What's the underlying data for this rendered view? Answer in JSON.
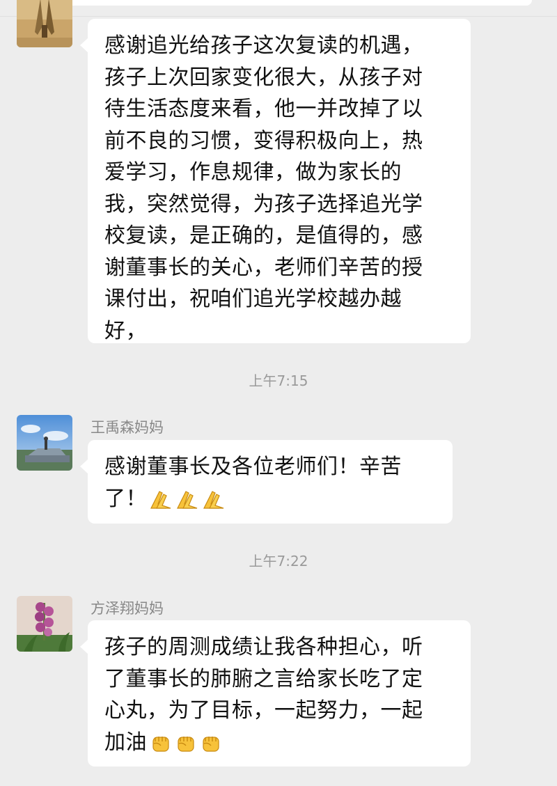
{
  "messages": [
    {
      "sender": "",
      "avatar_icon": "praying-hands-avatar-icon",
      "lines": [
        "感谢追光给孩子这次复读的机遇，",
        "孩子上次回家变化很大，从孩子对",
        "待生活态度来看，他一并改掉了以",
        "前不良的习惯，变得积极向上，热",
        "爱学习，作息规律，做为家长的",
        "我，突然觉得，为孩子选择追光学",
        "校复读，是正确的，是值得的，感",
        "谢董事长的关心，老师们辛苦的授",
        "课付出，祝咱们追光学校越办越",
        "好，"
      ]
    },
    {
      "timestamp": "上午7:15",
      "sender": "王禹森妈妈",
      "avatar_icon": "landscape-car-avatar-icon",
      "lines": [
        "感谢董事长及各位老师们！辛苦",
        "了！"
      ],
      "emoji": [
        "folded-hands-emoji-icon",
        "folded-hands-emoji-icon",
        "folded-hands-emoji-icon"
      ]
    },
    {
      "timestamp": "上午7:22",
      "sender": "方泽翔妈妈",
      "avatar_icon": "orchid-flower-avatar-icon",
      "lines": [
        "孩子的周测成绩让我各种担心，听",
        "了董事长的肺腑之言给家长吃了定",
        "心丸，为了目标，一起努力，一起",
        "加油"
      ],
      "emoji": [
        "raised-fist-emoji-icon",
        "raised-fist-emoji-icon",
        "raised-fist-emoji-icon"
      ]
    }
  ],
  "colors": {
    "background": "#ededed",
    "bubble": "#ffffff",
    "timestamp": "#9a9a9a",
    "sender_name": "#888888",
    "emoji_yellow": "#f7c23a"
  }
}
